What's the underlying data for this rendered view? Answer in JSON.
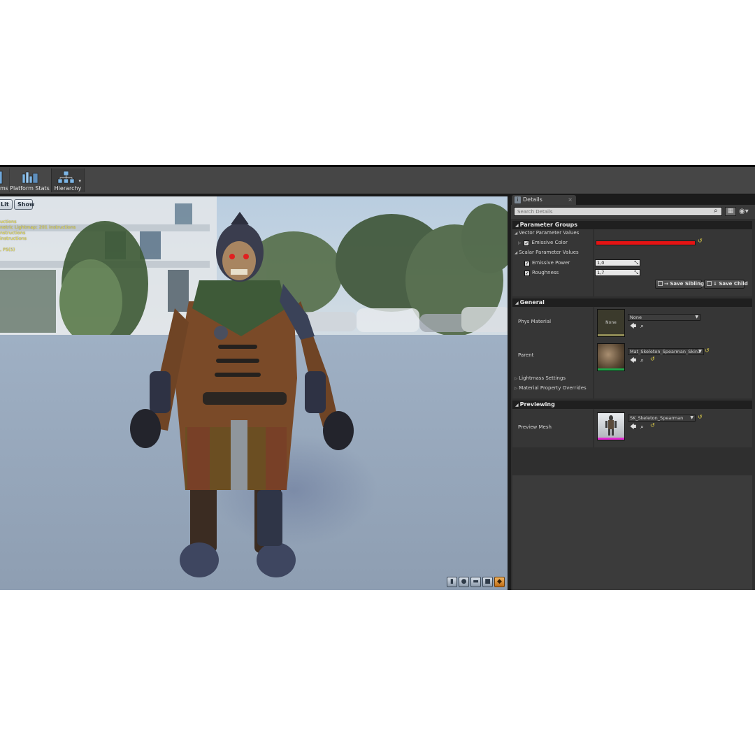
{
  "toolbar": {
    "items": [
      {
        "label": "ms",
        "icon": "stats-icon"
      },
      {
        "label": "Platform Stats",
        "icon": "platform-stats-icon"
      },
      {
        "label": "Hierarchy",
        "icon": "hierarchy-icon"
      }
    ]
  },
  "viewport": {
    "lit_button": "Lit",
    "show_button": "Show",
    "stats_lines": [
      "uctions",
      "netric Lightmap: 201 instructions",
      "nstructions",
      "instructions",
      "",
      ", PS(5)"
    ],
    "corner_icons": [
      "cylinder-icon",
      "sphere-icon",
      "plane-icon",
      "cube-icon",
      "custom-mesh-icon"
    ],
    "active_corner_icon": "custom-mesh-icon"
  },
  "details": {
    "tab_label": "Details",
    "tab_close": "×",
    "search_placeholder": "Search Details",
    "parameter_groups": {
      "header": "Parameter Groups",
      "vector_group": "Vector Parameter Values",
      "emissive_color_label": "Emissive Color",
      "emissive_color_value": "#e51414",
      "scalar_group": "Scalar Parameter Values",
      "emissive_power_label": "Emissive Power",
      "emissive_power_value": "1,0",
      "roughness_label": "Roughness",
      "roughness_value": "1,7",
      "save_sibling": "Save Sibling",
      "save_child": "Save Child"
    },
    "general": {
      "header": "General",
      "phys_material_label": "Phys Material",
      "phys_material_thumb": "None",
      "phys_material_value": "None",
      "parent_label": "Parent",
      "parent_value": "Mat_Skeleton_Spearman_Skin1",
      "lightmass_settings": "Lightmass Settings",
      "material_property_overrides": "Material Property Overrides"
    },
    "previewing": {
      "header": "Previewing",
      "preview_mesh_label": "Preview Mesh",
      "preview_mesh_value": "SK_Skeleton_Spearman"
    }
  }
}
